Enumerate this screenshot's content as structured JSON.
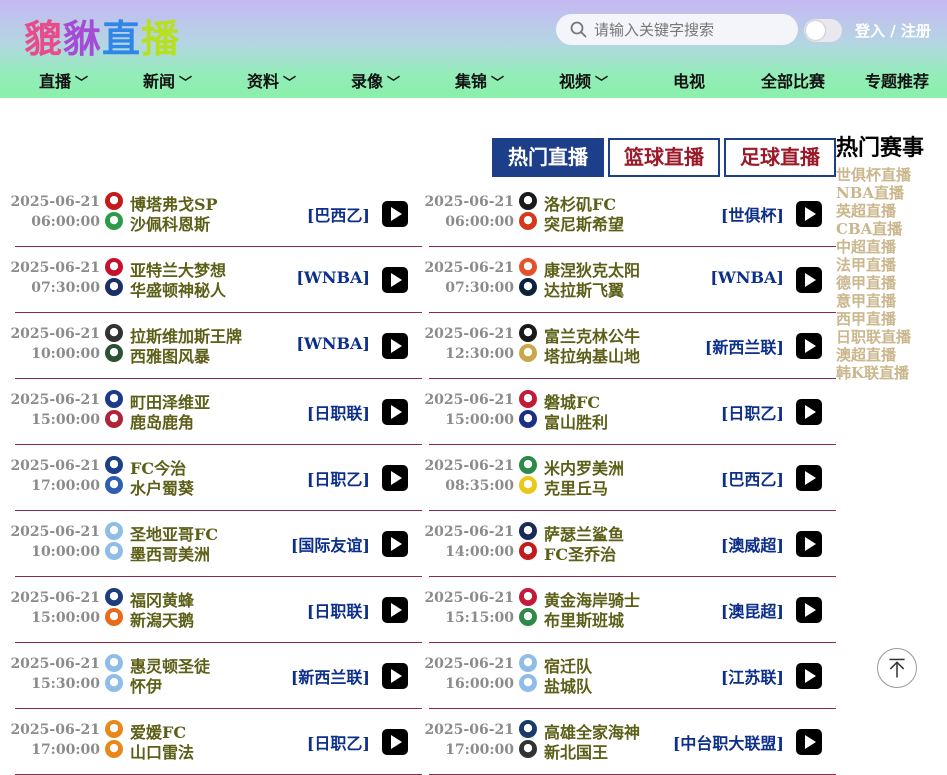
{
  "header": {
    "logo": [
      "貔",
      "貅",
      "直",
      "播"
    ],
    "search_placeholder": "请输入关键字搜索",
    "login": "登入 / 注册"
  },
  "nav": [
    {
      "label": "直播",
      "dropdown": true
    },
    {
      "label": "新闻",
      "dropdown": true
    },
    {
      "label": "资料",
      "dropdown": true
    },
    {
      "label": "录像",
      "dropdown": true
    },
    {
      "label": "集锦",
      "dropdown": true
    },
    {
      "label": "视频",
      "dropdown": true
    },
    {
      "label": "电视",
      "dropdown": false
    },
    {
      "label": "全部比赛",
      "dropdown": false
    },
    {
      "label": "专题推荐",
      "dropdown": false
    }
  ],
  "tabs": [
    {
      "label": "热门直播",
      "active": true
    },
    {
      "label": "篮球直播",
      "active": false
    },
    {
      "label": "足球直播",
      "active": false
    }
  ],
  "matches_left": [
    {
      "date": "2025-06-21",
      "time": "06:00:00",
      "home": "博塔弗戈SP",
      "away": "沙佩科恩斯",
      "league": "[巴西乙]",
      "home_color": "#c41a1a",
      "away_color": "#2e9a48"
    },
    {
      "date": "2025-06-21",
      "time": "07:30:00",
      "home": "亚特兰大梦想",
      "away": "华盛顿神秘人",
      "league": "[WNBA]",
      "home_color": "#c8102e",
      "away_color": "#1a2f6a"
    },
    {
      "date": "2025-06-21",
      "time": "10:00:00",
      "home": "拉斯维加斯王牌",
      "away": "西雅图风暴",
      "league": "[WNBA]",
      "home_color": "#333333",
      "away_color": "#2c5234"
    },
    {
      "date": "2025-06-21",
      "time": "15:00:00",
      "home": "町田泽维亚",
      "away": "鹿岛鹿角",
      "league": "[日职联]",
      "home_color": "#1b3a8c",
      "away_color": "#b0243a"
    },
    {
      "date": "2025-06-21",
      "time": "17:00:00",
      "home": "FC今治",
      "away": "水户蜀葵",
      "league": "[日职乙]",
      "home_color": "#1d3f8a",
      "away_color": "#2f5fb0"
    },
    {
      "date": "2025-06-21",
      "time": "10:00:00",
      "home": "圣地亚哥FC",
      "away": "墨西哥美洲",
      "league": "[国际友谊]",
      "home_color": "#8fbde8",
      "away_color": "#8fbde8"
    },
    {
      "date": "2025-06-21",
      "time": "15:00:00",
      "home": "福冈黄蜂",
      "away": "新潟天鹅",
      "league": "[日职联]",
      "home_color": "#1b3f7a",
      "away_color": "#e86a1a"
    },
    {
      "date": "2025-06-21",
      "time": "15:30:00",
      "home": "惠灵顿圣徒",
      "away": "怀伊",
      "league": "[新西兰联]",
      "home_color": "#8fbde8",
      "away_color": "#8fbde8"
    },
    {
      "date": "2025-06-21",
      "time": "17:00:00",
      "home": "爱媛FC",
      "away": "山口雷法",
      "league": "[日职乙]",
      "home_color": "#e8871a",
      "away_color": "#e8871a"
    }
  ],
  "matches_right": [
    {
      "date": "2025-06-21",
      "time": "06:00:00",
      "home": "洛杉矶FC",
      "away": "突尼斯希望",
      "league": "[世俱杯]",
      "home_color": "#1a1a1a",
      "away_color": "#d4391a"
    },
    {
      "date": "2025-06-21",
      "time": "07:30:00",
      "home": "康涅狄克太阳",
      "away": "达拉斯飞翼",
      "league": "[WNBA]",
      "home_color": "#e8502a",
      "away_color": "#0c2340"
    },
    {
      "date": "2025-06-21",
      "time": "12:30:00",
      "home": "富兰克林公牛",
      "away": "塔拉纳基山地",
      "league": "[新西兰联]",
      "home_color": "#1a1a1a",
      "away_color": "#c8a84a"
    },
    {
      "date": "2025-06-21",
      "time": "15:00:00",
      "home": "磐城FC",
      "away": "富山胜利",
      "league": "[日职乙]",
      "home_color": "#c41a3a",
      "away_color": "#1a2f8a"
    },
    {
      "date": "2025-06-21",
      "time": "08:35:00",
      "home": "米内罗美洲",
      "away": "克里丘马",
      "league": "[巴西乙]",
      "home_color": "#2e8a48",
      "away_color": "#e8c81a"
    },
    {
      "date": "2025-06-21",
      "time": "14:00:00",
      "home": "萨瑟兰鲨鱼",
      "away": "FC圣乔治",
      "league": "[澳威超]",
      "home_color": "#1a2a5a",
      "away_color": "#c41a1a"
    },
    {
      "date": "2025-06-21",
      "time": "15:15:00",
      "home": "黄金海岸骑士",
      "away": "布里斯班城",
      "league": "[澳昆超]",
      "home_color": "#c41a3a",
      "away_color": "#2e8a48"
    },
    {
      "date": "2025-06-21",
      "time": "16:00:00",
      "home": "宿迁队",
      "away": "盐城队",
      "league": "[江苏联]",
      "home_color": "#8fbde8",
      "away_color": "#8fbde8"
    },
    {
      "date": "2025-06-21",
      "time": "17:00:00",
      "home": "高雄全家海神",
      "away": "新北国王",
      "league": "[中台职大联盟]",
      "home_color": "#1a3a6a",
      "away_color": "#333333"
    }
  ],
  "hot_events": {
    "title": "热门赛事",
    "items": [
      "世俱杯直播",
      "NBA直播",
      "英超直播",
      "CBA直播",
      "中超直播",
      "法甲直播",
      "德甲直播",
      "意甲直播",
      "西甲直播",
      "日职联直播",
      "澳超直播",
      "韩K联直播"
    ]
  },
  "colors": {
    "accent": "#1d3f8a",
    "tab_text": "#9b1a2a",
    "team_text": "#5d5f18",
    "league_text": "#0d2f8c",
    "hot_item": "#cbb78e",
    "divider": "#8a2b48"
  },
  "icons": {
    "search": "search-icon",
    "play": "play-icon",
    "back_to_top": "arrow-up-icon"
  }
}
